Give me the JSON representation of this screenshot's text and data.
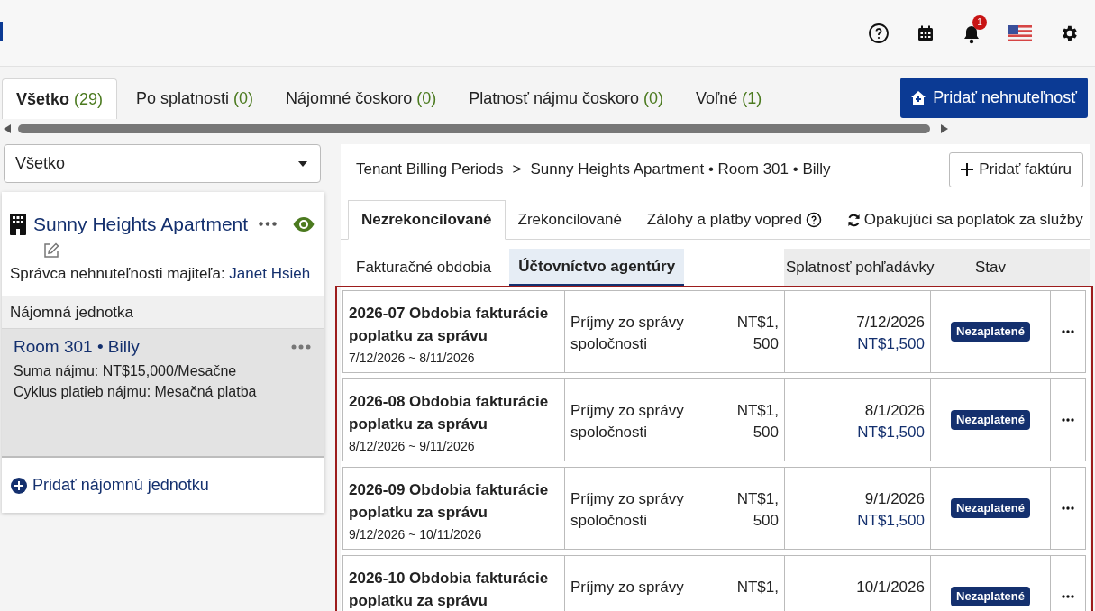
{
  "header": {
    "notification_count": "1"
  },
  "property_tabs": [
    {
      "label": "Všetko",
      "count": "(29)",
      "selected": true
    },
    {
      "label": "Po splatnosti",
      "count": "(0)",
      "selected": false
    },
    {
      "label": "Nájomné čoskoro",
      "count": "(0)",
      "selected": false
    },
    {
      "label": "Platnosť nájmu čoskoro",
      "count": "(0)",
      "selected": false
    },
    {
      "label": "Voľné",
      "count": "(1)",
      "selected": false
    }
  ],
  "add_property_button": "Pridať nehnuteľnosť",
  "filter": {
    "value": "Všetko"
  },
  "property": {
    "name": "Sunny Heights Apartment",
    "manager_label": "Správca nehnuteľnosti majiteľa:",
    "manager": "Janet Hsieh",
    "units_heading": "Nájomná jednotka",
    "units": [
      {
        "title": "Room 301 • Billy",
        "rent": "Suma nájmu: NT$15,000/Mesačne",
        "cycle": "Cyklus platieb nájmu: Mesačná platba",
        "selected": true
      }
    ],
    "add_unit": "Pridať nájomnú jednotku"
  },
  "breadcrumb": {
    "items": [
      "Tenant Billing Periods",
      "Sunny Heights Apartment • Room 301 • Billy"
    ],
    "separator": ">"
  },
  "add_invoice_button": "Pridať faktúru",
  "billing_tabs": [
    {
      "label": "Nezrekoncilované",
      "kind": "plain",
      "selected": true
    },
    {
      "label": "Zrekoncilované",
      "kind": "plain",
      "selected": false
    },
    {
      "label": "Zálohy a platby vopred",
      "kind": "help",
      "selected": false
    },
    {
      "label": "Opakujúci sa poplatok za služby",
      "kind": "recurring",
      "selected": false
    }
  ],
  "sub_tabs": [
    {
      "label": "Fakturačné obdobia",
      "selected": false
    },
    {
      "label": "Účtovníctvo agentúry",
      "selected": true
    }
  ],
  "table": {
    "columns": [
      "Splatnosť pohľadávky",
      "Stav"
    ],
    "rows": [
      {
        "title": "2026-07 Obdobia fakturácie poplatku za správu",
        "period": "7/12/2026 ~ 8/11/2026",
        "item": "Príjmy zo správy spoločnosti",
        "amount": "NT$1, 500",
        "due_date": "7/12/2026",
        "due_amount": "NT$1,500",
        "status": "Nezaplatené"
      },
      {
        "title": "2026-08 Obdobia fakturácie poplatku za správu",
        "period": "8/12/2026 ~ 9/11/2026",
        "item": "Príjmy zo správy spoločnosti",
        "amount": "NT$1, 500",
        "due_date": "8/1/2026",
        "due_amount": "NT$1,500",
        "status": "Nezaplatené"
      },
      {
        "title": "2026-09 Obdobia fakturácie poplatku za správu",
        "period": "9/12/2026 ~ 10/11/2026",
        "item": "Príjmy zo správy spoločnosti",
        "amount": "NT$1, 500",
        "due_date": "9/1/2026",
        "due_amount": "NT$1,500",
        "status": "Nezaplatené"
      },
      {
        "title": "2026-10 Obdobia fakturácie poplatku za správu",
        "item": "Príjmy zo správy",
        "amount": "NT$1,",
        "due_date": "10/1/2026",
        "status": "Nezaplatené"
      }
    ]
  }
}
